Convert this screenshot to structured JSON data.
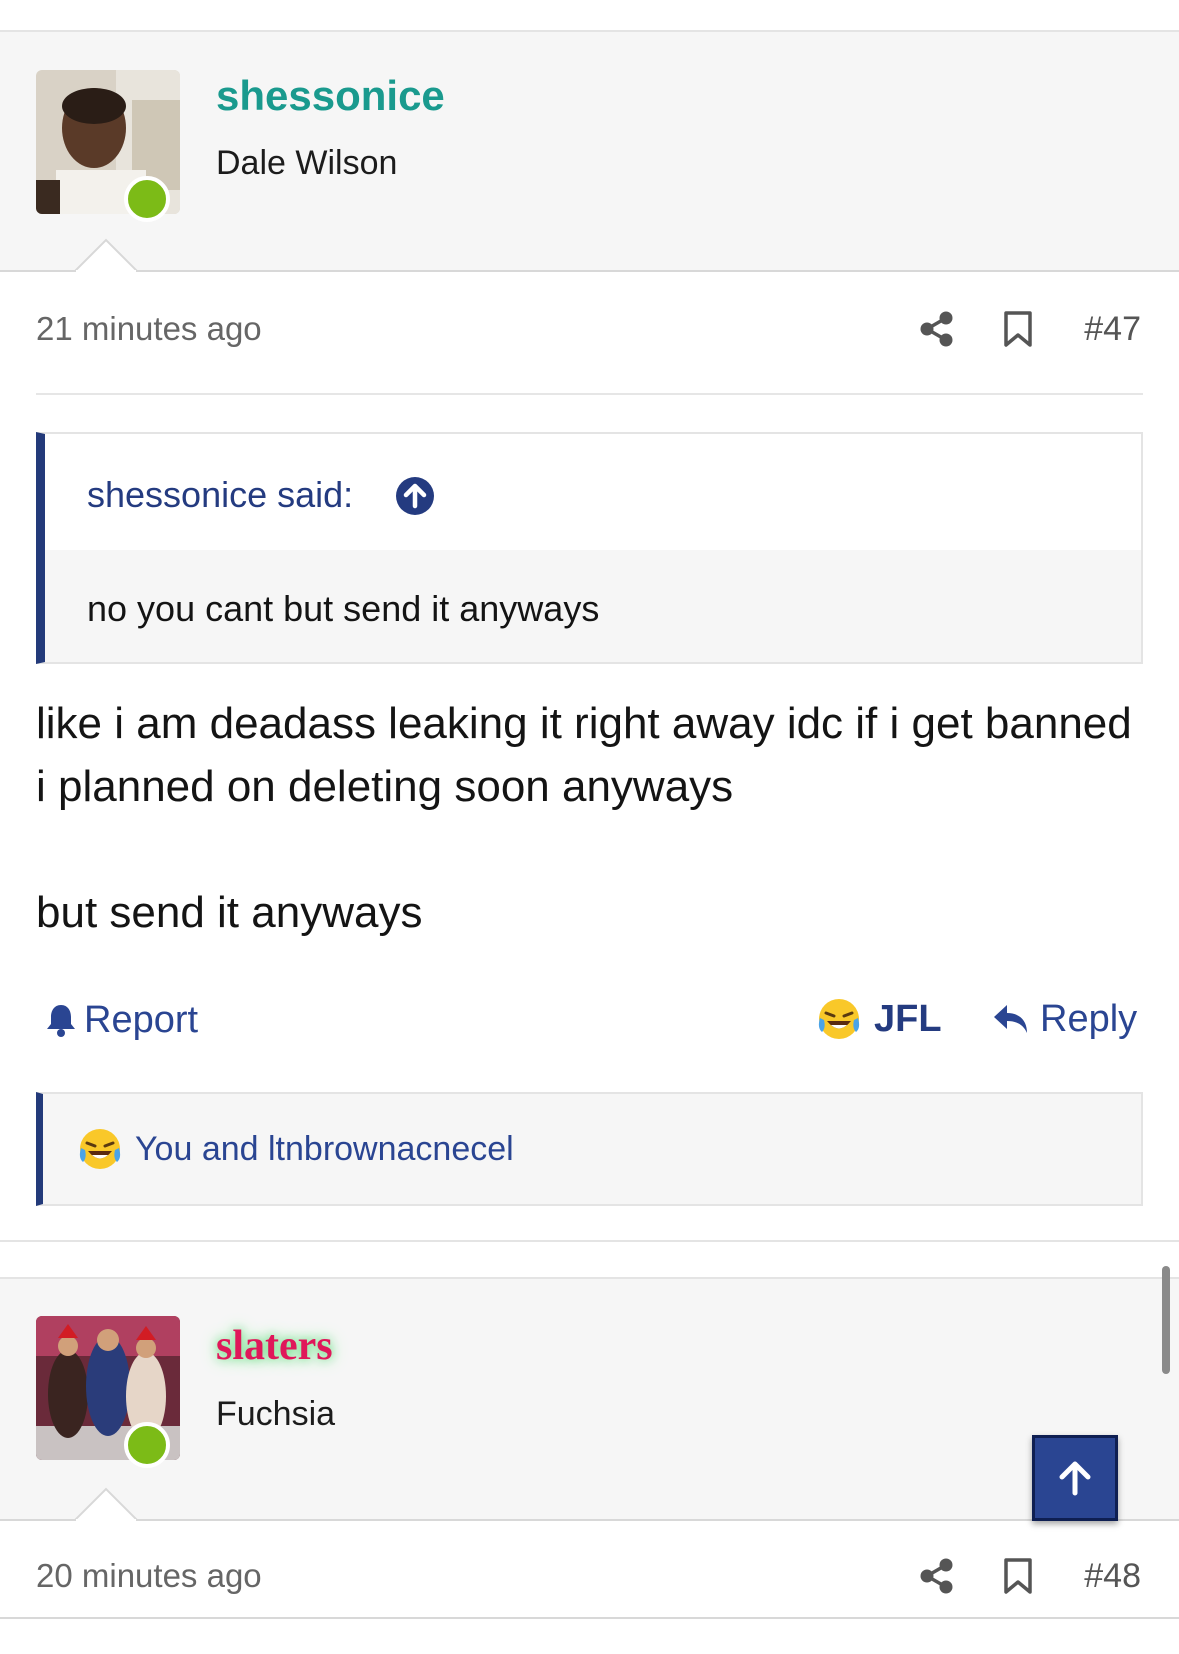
{
  "posts": [
    {
      "username": "shessonice",
      "user_title": "Dale Wilson",
      "time": "21 minutes ago",
      "post_number": "#47",
      "quote": {
        "author": "shessonice said:",
        "text": "no you cant but send it anyways"
      },
      "body": [
        "like i am deadass leaking it right away idc if i get banned i planned on deleting soon anyways",
        "but send it anyways"
      ],
      "actions": {
        "report": "Report",
        "jfl": "JFL",
        "reply": "Reply"
      },
      "reactions_text": "You and ltnbrownacnecel"
    },
    {
      "username": "slaters",
      "user_title": "Fuchsia",
      "time": "20 minutes ago",
      "post_number": "#48"
    }
  ],
  "colors": {
    "username_teal": "#1a9a8e",
    "username_pink": "#e0175a",
    "link_blue": "#2a4592",
    "quote_border": "#233a7a",
    "online_green": "#7cbb17"
  },
  "icons": [
    "share-icon",
    "bookmark-icon",
    "arrow-up-circle-icon",
    "bell-icon",
    "laughing-crying-emoji-icon",
    "reply-arrow-icon",
    "arrow-up-icon"
  ]
}
